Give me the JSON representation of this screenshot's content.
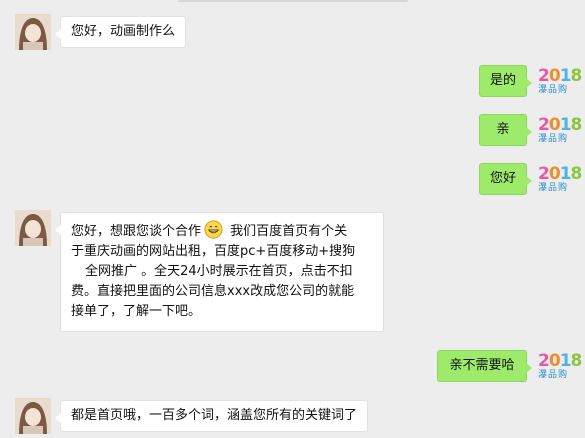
{
  "colors": {
    "background": "#ededed",
    "incoming_bubble": "#ffffff",
    "outgoing_bubble": "#9eea6a"
  },
  "logo": {
    "year_digits": [
      "2",
      "0",
      "1",
      "8"
    ],
    "caption": "瀑品购"
  },
  "messages": [
    {
      "side": "left",
      "text": "您好，动画制作么"
    },
    {
      "side": "right",
      "text": "是的"
    },
    {
      "side": "right",
      "text": "亲"
    },
    {
      "side": "right",
      "text": "您好"
    },
    {
      "side": "left",
      "lines": [
        "您好，想跟您谈个合作",
        "我们百度首页有个关",
        "于重庆动画的网站出租，百度pc+百度移动+搜狗",
        "全网推广 。全天24小时展示在首页，点击不扣",
        "费。直接把里面的公司信息xxx改成您公司的就能",
        "接单了，了解一下吧。"
      ],
      "emoji": "grinning-face-emoji"
    },
    {
      "side": "right",
      "text": "亲不需要哈"
    },
    {
      "side": "left",
      "text": "都是首页哦，一百多个词，涵盖您所有的关键词了"
    }
  ]
}
